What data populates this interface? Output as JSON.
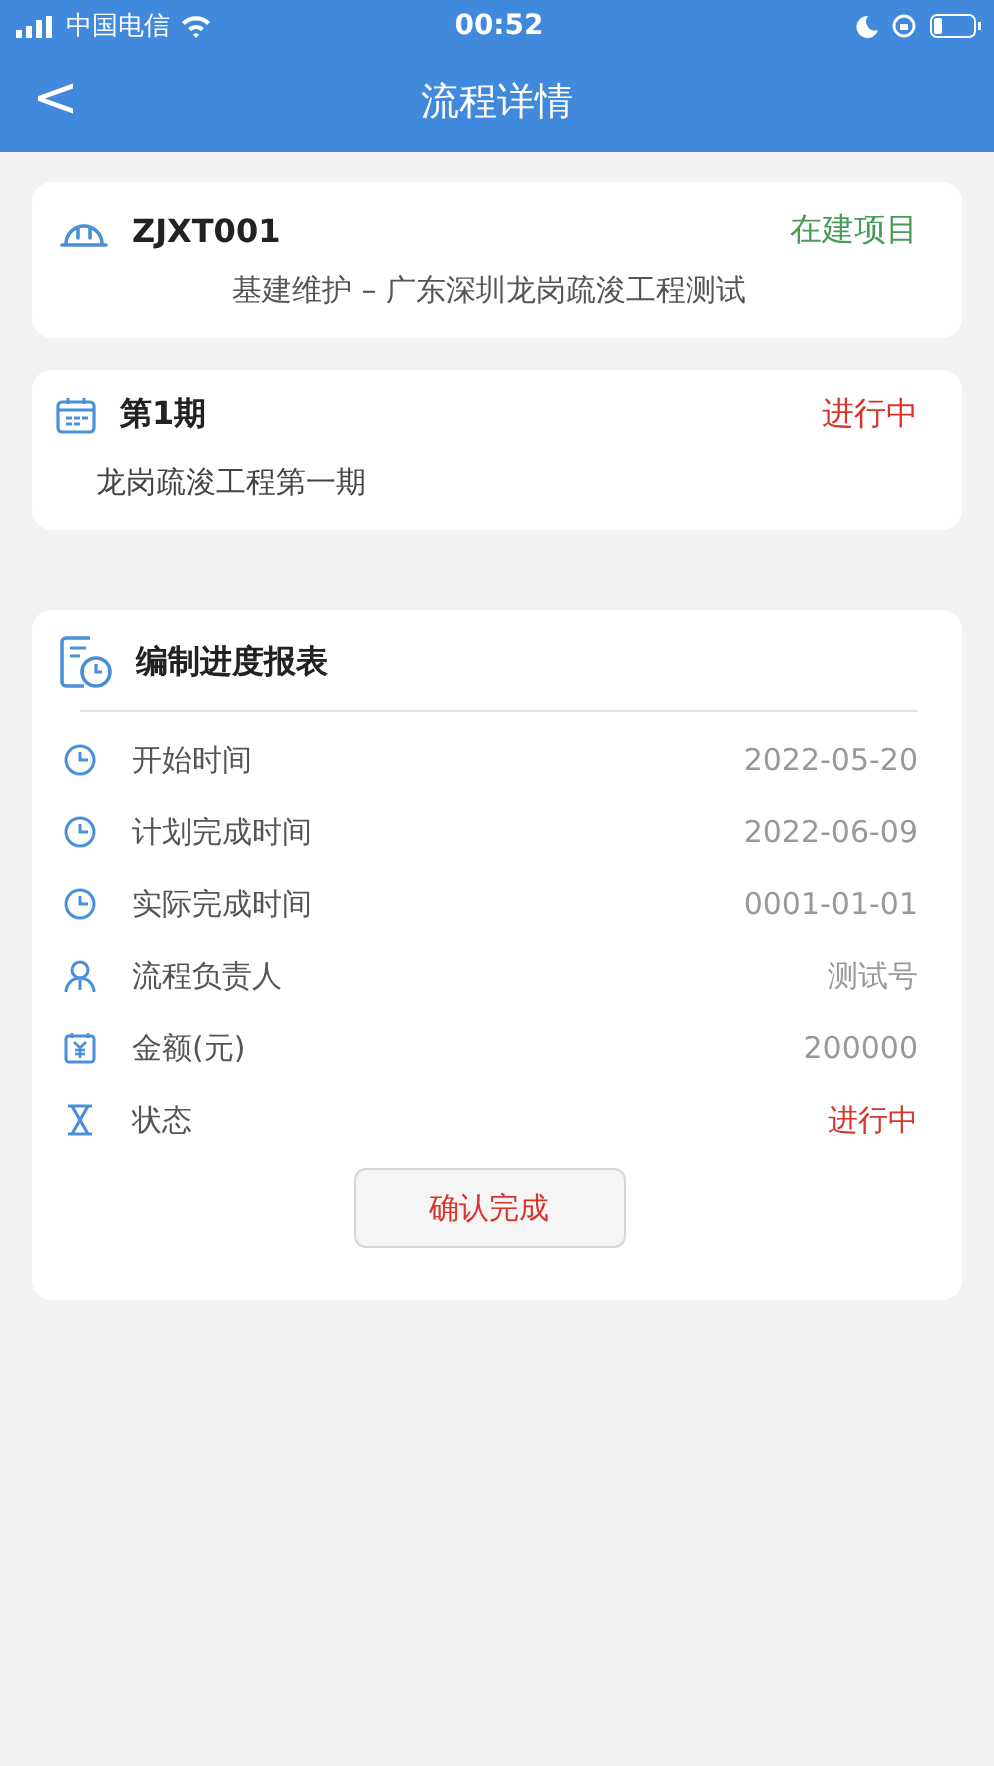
{
  "status_bar": {
    "carrier": "中国电信",
    "time": "00:52"
  },
  "nav": {
    "back": "<",
    "title": "流程详情"
  },
  "project": {
    "code": "ZJXT001",
    "status": {
      "text": "在建项目",
      "color": "#4a9a5a"
    },
    "name": "基建维护 – 广东深圳龙岗疏浚工程测试"
  },
  "phase": {
    "title": "第1期",
    "status": {
      "text": "进行中",
      "color": "#d9342b"
    },
    "name": "龙岗疏浚工程第一期"
  },
  "report": {
    "title": "编制进度报表",
    "rows": [
      {
        "kind": "time",
        "label": "开始时间",
        "value": "2022-05-20"
      },
      {
        "kind": "time",
        "label": "计划完成时间",
        "value": "2022-06-09"
      },
      {
        "kind": "time",
        "label": "实际完成时间",
        "value": "0001-01-01"
      },
      {
        "kind": "person",
        "label": "流程负责人",
        "value": "测试号"
      },
      {
        "kind": "money",
        "label": "金额(元)",
        "value": "200000"
      },
      {
        "kind": "status",
        "label": "状态",
        "value": "进行中"
      }
    ],
    "button": "确认完成"
  }
}
